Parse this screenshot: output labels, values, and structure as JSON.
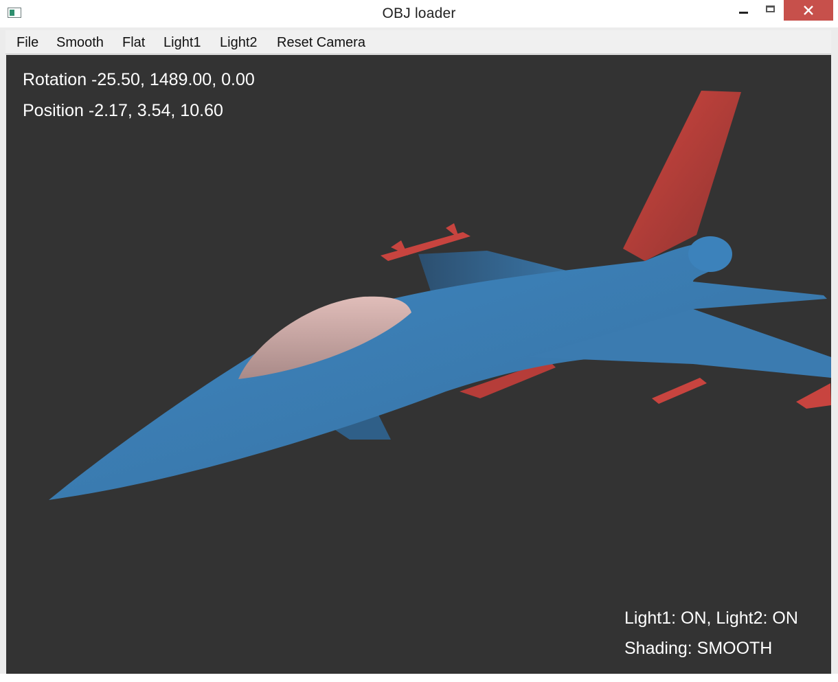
{
  "window": {
    "title": "OBJ loader",
    "app_icon": "window-app-icon",
    "controls": {
      "minimize": "minimize-icon",
      "maximize": "maximize-icon",
      "close": "close-icon"
    }
  },
  "menu": {
    "items": [
      {
        "label": "File"
      },
      {
        "label": "Smooth"
      },
      {
        "label": "Flat"
      },
      {
        "label": "Light1"
      },
      {
        "label": "Light2"
      },
      {
        "label": "Reset Camera"
      }
    ]
  },
  "viewport": {
    "background": "#333333",
    "model_colors": {
      "body": "#3f7fb5",
      "canopy": "#c9a5a2",
      "accents": "#c8443f"
    },
    "hud": {
      "rotation": "Rotation -25.50, 1489.00, 0.00",
      "position": "Position -2.17, 3.54, 10.60",
      "lights": "Light1: ON, Light2: ON",
      "shading": "Shading: SMOOTH"
    }
  }
}
